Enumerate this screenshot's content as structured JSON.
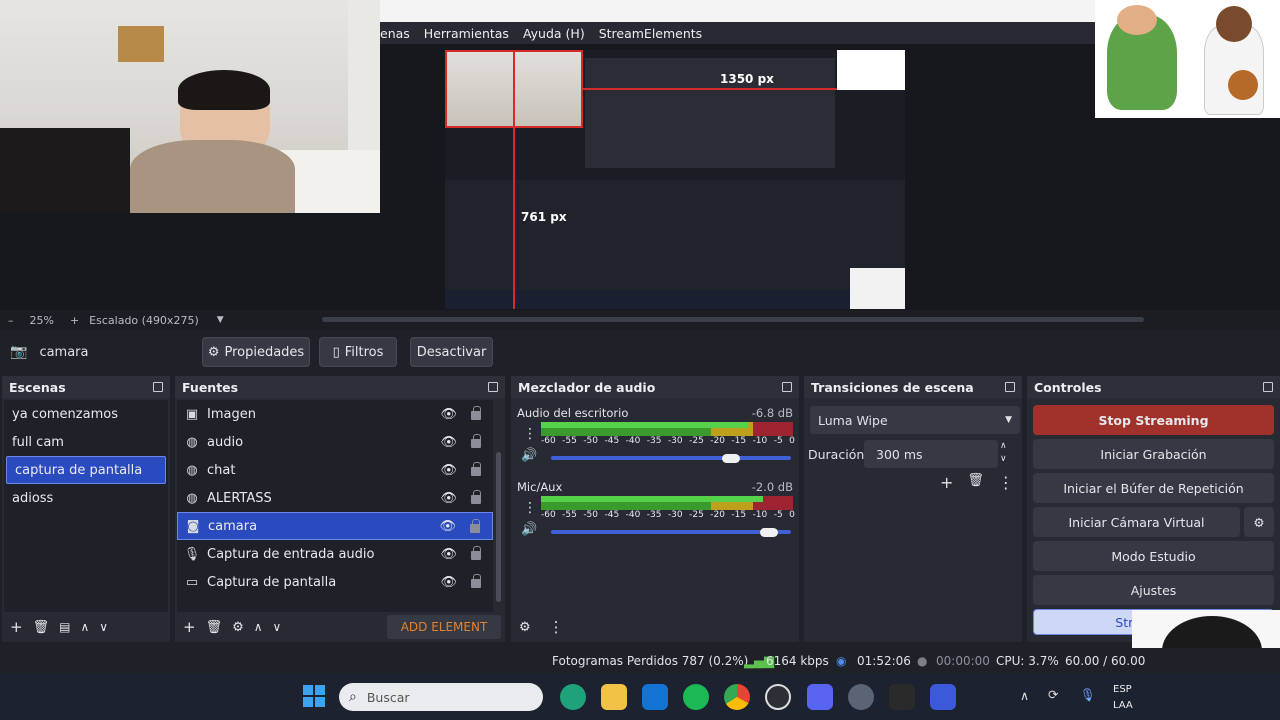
{
  "menubar": {
    "items": [
      "enas",
      "Herramientas",
      "Ayuda (H)",
      "StreamElements"
    ]
  },
  "preview": {
    "overlay_width_label": "1350 px",
    "overlay_height_label": "761 px"
  },
  "zoom": {
    "level": "25%",
    "scaling": "Escalado (490x275)"
  },
  "source_toolbar": {
    "selected_source": "camara",
    "properties_label": "Propiedades",
    "filters_label": "Filtros",
    "deactivate_label": "Desactivar"
  },
  "scenes": {
    "title": "Escenas",
    "items": [
      "ya comenzamos",
      "full cam",
      "captura de pantalla",
      "adioss"
    ],
    "selected": "captura de pantalla"
  },
  "sources": {
    "title": "Fuentes",
    "items": [
      {
        "label": "Imagen",
        "icon": "image-icon"
      },
      {
        "label": "audio",
        "icon": "browser-icon"
      },
      {
        "label": "chat",
        "icon": "browser-icon"
      },
      {
        "label": "ALERTASS",
        "icon": "browser-icon"
      },
      {
        "label": "camara",
        "icon": "camera-icon"
      },
      {
        "label": "Captura de entrada audio",
        "icon": "mic-icon"
      },
      {
        "label": "Captura de pantalla",
        "icon": "monitor-icon"
      }
    ],
    "add_element_label": "ADD ELEMENT"
  },
  "mixer": {
    "title": "Mezclador de audio",
    "channels": [
      {
        "name": "Audio del escritorio",
        "db": "-6.8 dB",
        "level": 0.82,
        "volume": 0.75
      },
      {
        "name": "Mic/Aux",
        "db": "-2.0 dB",
        "level": 0.88,
        "volume": 0.91
      }
    ],
    "ticks": [
      "-60",
      "-55",
      "-50",
      "-45",
      "-40",
      "-35",
      "-30",
      "-25",
      "-20",
      "-15",
      "-10",
      "-5",
      "0"
    ]
  },
  "transitions": {
    "title": "Transiciones de escena",
    "selected": "Luma Wipe",
    "duration_label": "Duración",
    "duration_value": "300 ms"
  },
  "controls": {
    "title": "Controles",
    "stop_streaming": "Stop Streaming",
    "start_recording": "Iniciar Grabación",
    "replay_buffer": "Iniciar el Búfer de Repetición",
    "virtual_camera": "Iniciar Cámara Virtual",
    "studio_mode": "Modo Estudio",
    "settings": "Ajustes",
    "streamelements": "StreamElem"
  },
  "status": {
    "dropped_frames": "Fotogramas Perdidos 787 (0.2%)",
    "bitrate": "6164 kbps",
    "stream_time": "01:52:06",
    "record_time": "00:00:00",
    "cpu": "CPU: 3.7%",
    "fps": "60.00 / 60.00"
  },
  "taskbar": {
    "search_placeholder": "Buscar",
    "lang": "ESP",
    "lang2": "LAA"
  },
  "colors": {
    "accent": "#2a4ac0",
    "stop": "#a0322b",
    "panel": "#272a33"
  }
}
